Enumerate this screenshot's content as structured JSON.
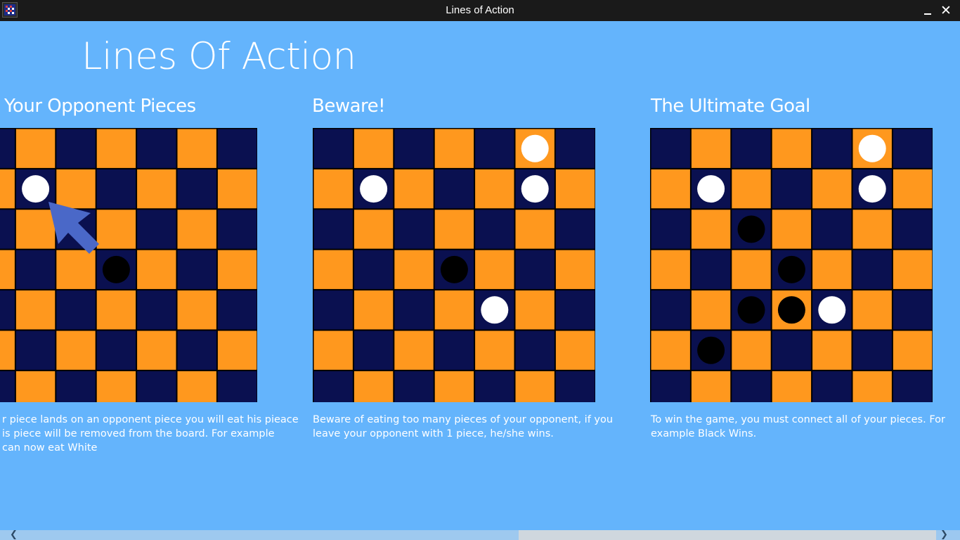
{
  "window": {
    "title": "Lines of Action",
    "close_glyph": "✕"
  },
  "app": {
    "title": "Lines Of Action"
  },
  "colors": {
    "dark": "#0a1050",
    "light": "#ff981e",
    "white_piece": "#ffffff",
    "black_piece": "#000000",
    "background": "#64b4fc"
  },
  "sections": [
    {
      "title": "Your Opponent Pieces",
      "description": [
        "r piece lands on an opponent piece you will eat his pieace",
        "is piece will be removed from the board. For example",
        "can now eat White"
      ],
      "board": {
        "size": 8,
        "white": [
          [
            1,
            1
          ]
        ],
        "black": [
          [
            3,
            3
          ]
        ],
        "arrow": true
      }
    },
    {
      "title": "Beware!",
      "description": [
        "Beware of eating too many pieces of your opponent, if you",
        "leave your opponent with 1 piece, he/she wins."
      ],
      "board": {
        "size": 7,
        "white": [
          [
            0,
            5
          ],
          [
            1,
            1
          ],
          [
            1,
            5
          ],
          [
            4,
            4
          ]
        ],
        "black": [
          [
            3,
            3
          ]
        ]
      }
    },
    {
      "title": "The Ultimate Goal",
      "description": [
        "To win the game, you must connect all of your pieces. For",
        "example Black Wins."
      ],
      "board": {
        "size": 7,
        "white": [
          [
            0,
            5
          ],
          [
            1,
            1
          ],
          [
            1,
            5
          ],
          [
            4,
            4
          ]
        ],
        "black": [
          [
            2,
            2
          ],
          [
            3,
            3
          ],
          [
            4,
            2
          ],
          [
            4,
            3
          ],
          [
            5,
            1
          ]
        ]
      }
    }
  ]
}
